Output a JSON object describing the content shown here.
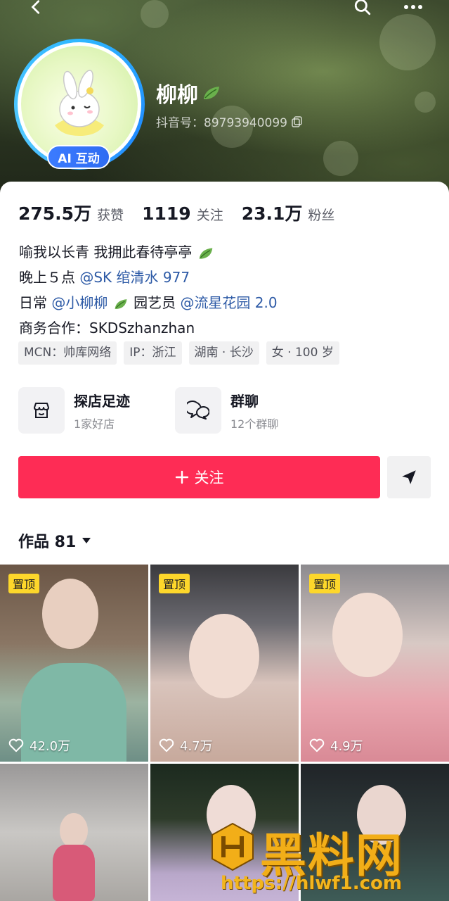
{
  "header": {
    "name": "柳柳",
    "douyin_id": "抖音号：89793940099",
    "ai_badge": "AI 互动"
  },
  "stats": [
    {
      "value": "275.5万",
      "label": "获赞"
    },
    {
      "value": "1119",
      "label": "关注"
    },
    {
      "value": "23.1万",
      "label": "粉丝"
    }
  ],
  "bio": {
    "line1": "喻我以长青  我拥此春待亭亭",
    "line2_prefix": "晚上５点 ",
    "line2_mention": "@SK 绾清水 977",
    "line3_prefix": "日常 ",
    "line3_mention1": "@小柳柳",
    "line3_middle": " 园艺员 ",
    "line3_mention2": "@流星花园 2.0",
    "line4": "商务合作：SKDSzhanzhan"
  },
  "tags": [
    "MCN：帅库网络",
    "IP：浙江",
    "湖南 · 长沙",
    "女 · 100 岁"
  ],
  "shortcuts": [
    {
      "title": "探店足迹",
      "subtitle": "1家好店",
      "icon": "store-icon"
    },
    {
      "title": "群聊",
      "subtitle": "12个群聊",
      "icon": "chat-icon"
    }
  ],
  "actions": {
    "follow_label": "关注",
    "share_icon": "send-icon"
  },
  "works": {
    "label": "作品 81"
  },
  "grid": [
    {
      "pinned": "置顶",
      "likes": "42.0万"
    },
    {
      "pinned": "置顶",
      "likes": "4.7万"
    },
    {
      "pinned": "置顶",
      "likes": "4.9万"
    },
    {
      "pinned": "",
      "likes": ""
    },
    {
      "pinned": "",
      "likes": ""
    },
    {
      "pinned": "",
      "likes": ""
    }
  ],
  "watermark": {
    "title": "黑料网",
    "url": "https://hlwf1.com"
  },
  "colors": {
    "accent": "#fe2c55",
    "mention": "#2d5aa6",
    "pin": "#fdd72b",
    "ai_badge": "#3b7bff"
  }
}
